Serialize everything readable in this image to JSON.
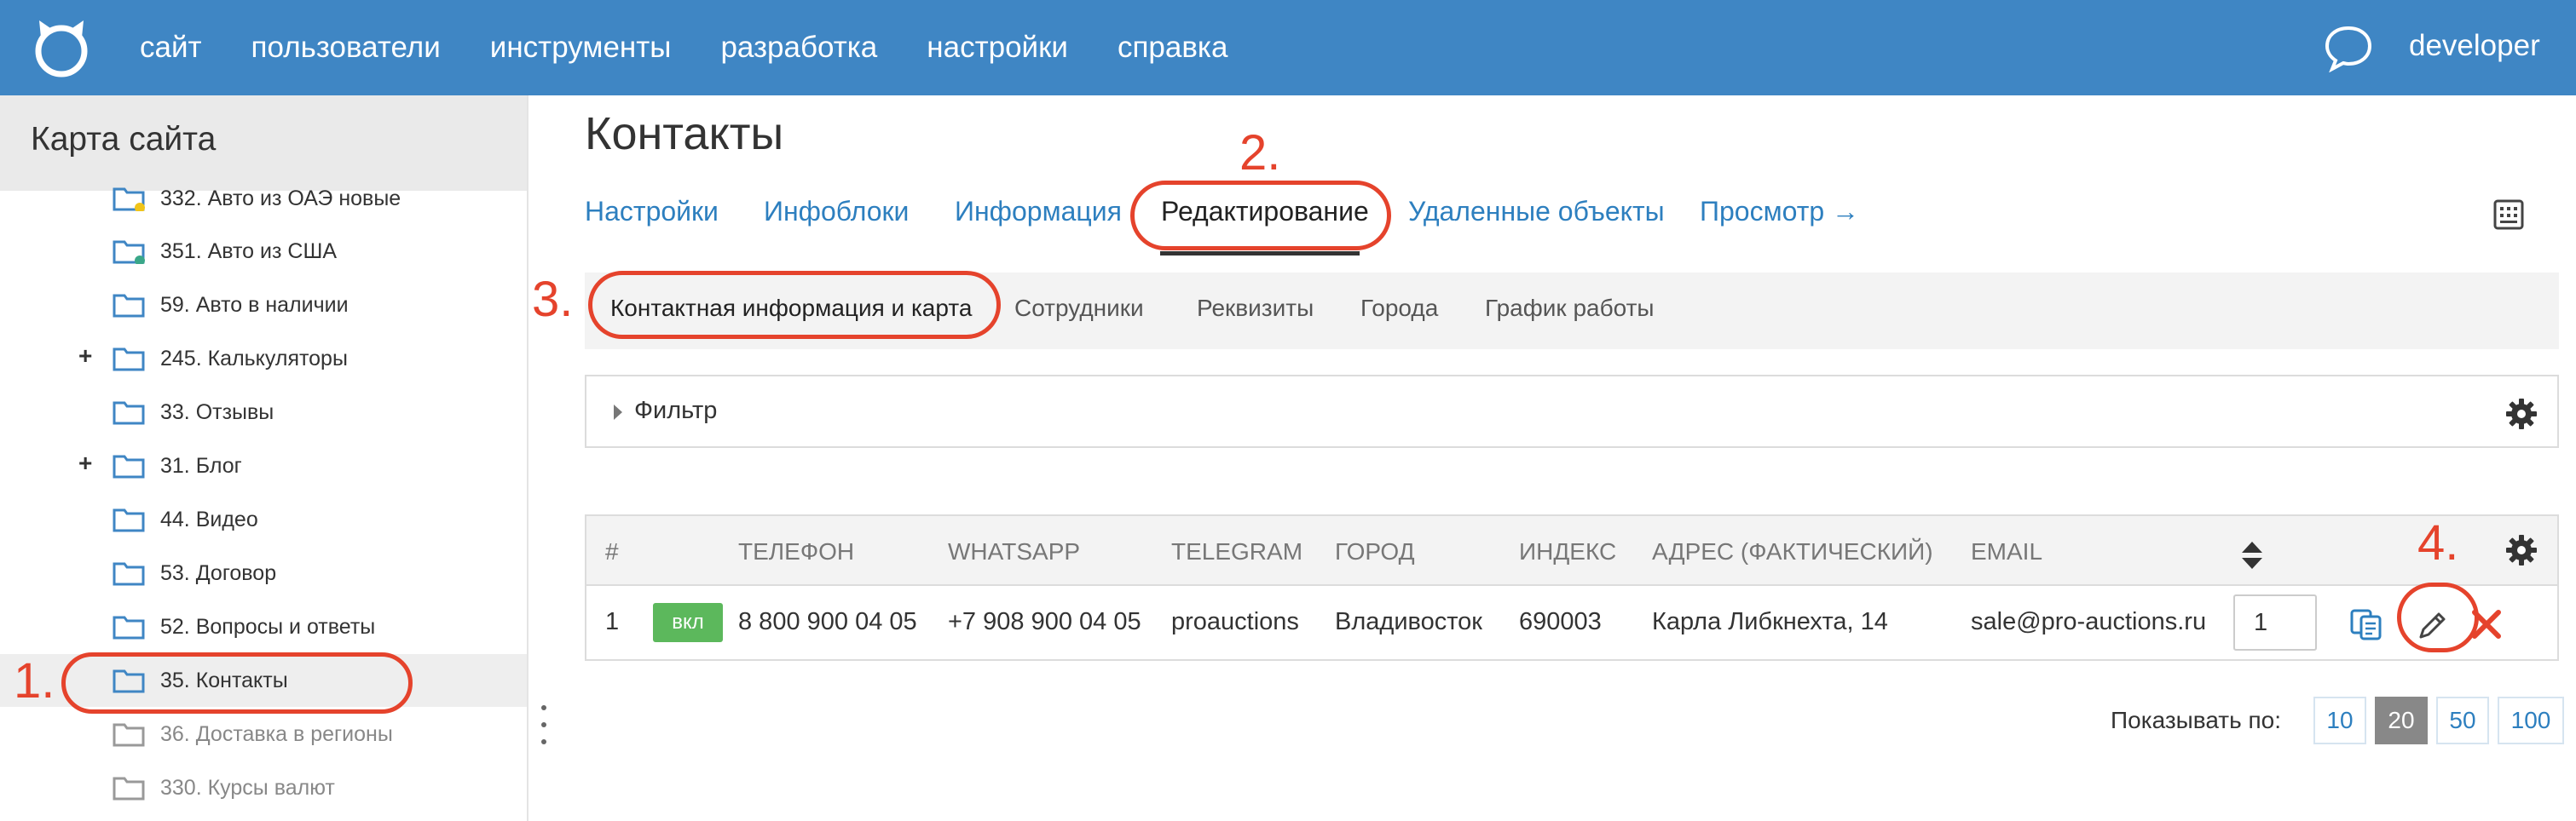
{
  "topbar": {
    "logo": "cat-logo-icon",
    "nav": [
      "сайт",
      "пользователи",
      "инструменты",
      "разработка",
      "настройки",
      "справка"
    ],
    "user": "developer",
    "chat_icon": "chat-bubble-icon"
  },
  "sidebar": {
    "title": "Карта сайта",
    "items": [
      {
        "label": "332. Авто из ОАЭ новые",
        "status": "yellow"
      },
      {
        "label": "351. Авто из США",
        "status": "green"
      },
      {
        "label": "59. Авто в наличии"
      },
      {
        "label": "245. Калькуляторы",
        "expandable": "+"
      },
      {
        "label": "33. Отзывы"
      },
      {
        "label": "31. Блог",
        "expandable": "+"
      },
      {
        "label": "44. Видео"
      },
      {
        "label": "53. Договор"
      },
      {
        "label": "52. Вопросы и ответы"
      },
      {
        "label": "35. Контакты",
        "active": true
      },
      {
        "label": "36. Доставка в регионы",
        "muted": true
      },
      {
        "label": "330. Курсы валют",
        "muted": true
      }
    ]
  },
  "main": {
    "title": "Контакты",
    "tabs": [
      "Настройки",
      "Инфоблоки",
      "Информация",
      "Редактирование",
      "Удаленные объекты",
      "Просмотр →"
    ],
    "active_tab": "Редактирование",
    "subtabs": [
      "Контактная информация и карта",
      "Сотрудники",
      "Реквизиты",
      "Города",
      "График работы"
    ],
    "active_subtab": "Контактная информация и карта",
    "filter_label": "Фильтр",
    "table": {
      "headers": [
        "#",
        "ТЕЛЕФОН",
        "WHATSAPP",
        "TELEGRAM",
        "ГОРОД",
        "ИНДЕКС",
        "АДРЕС (ФАКТИЧЕСКИЙ)",
        "EMAIL"
      ],
      "row": {
        "num": "1",
        "badge": "вкл",
        "phone": "8 800 900 04 05",
        "whatsapp": "+7 908 900 04 05",
        "telegram": "proauctions",
        "city": "Владивосток",
        "index": "690003",
        "address": "Карла Либкнехта, 14",
        "email": "sale@pro-auctions.ru",
        "order": "1"
      }
    },
    "pager": {
      "label": "Показывать по:",
      "options": [
        "10",
        "20",
        "50",
        "100"
      ],
      "active": "20"
    }
  },
  "annotations": [
    "1.",
    "2.",
    "3.",
    "4."
  ],
  "colors": {
    "topbar": "#3f86c4",
    "link": "#2d7fbf",
    "annotation": "#e5432c",
    "badge": "#5cb85c",
    "folder": "#3f86c4"
  }
}
